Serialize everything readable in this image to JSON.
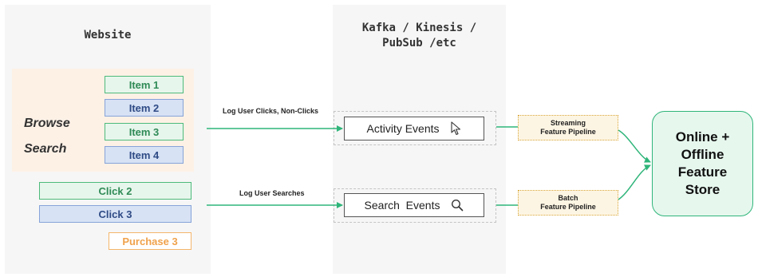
{
  "website": {
    "title": "Website",
    "browse_label": "Browse",
    "search_label": "Search",
    "items": [
      "Item 1",
      "Item 2",
      "Item 3",
      "Item 4"
    ],
    "clicks": [
      "Click 2",
      "Click 3"
    ],
    "purchase": "Purchase 3"
  },
  "stream": {
    "title_line1": "Kafka / Kinesis /",
    "title_line2": "PubSub /etc",
    "activity_events": "Activity Events",
    "search_events": "Search  Events"
  },
  "edges": {
    "clicks_label": "Log User Clicks, Non-Clicks",
    "searches_label": "Log User Searches"
  },
  "pipelines": {
    "streaming_line1": "Streaming",
    "streaming_line2": "Feature Pipeline",
    "batch_line1": "Batch",
    "batch_line2": "Feature Pipeline"
  },
  "store": {
    "line1": "Online +",
    "line2": "Offline",
    "line3": "Feature",
    "line4": "Store"
  },
  "colors": {
    "arrow": "#2fb57a",
    "green_item": "#4dba7b",
    "blue_item": "#86a3d8",
    "purchase": "#f0a24c"
  },
  "icons": [
    "cursor-icon",
    "search-icon"
  ]
}
